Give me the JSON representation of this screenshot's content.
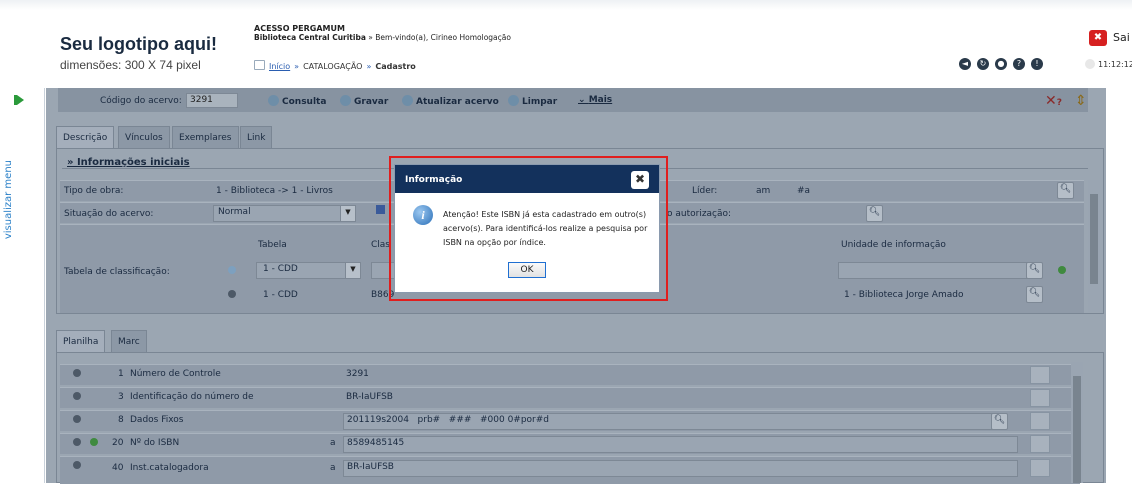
{
  "header": {
    "logo_title": "Seu logotipo aqui!",
    "logo_dimensions": "dimensões: 300 X 74 pixel",
    "system_name": "ACESSO PERGAMUM",
    "library_line_bold": "Biblioteca Central Curitiba",
    "library_line_rest": " » Bem-vindo(a), Cirineo Homologação",
    "breadcrumb": {
      "home": "Início",
      "section": "CATALOGAÇÃO",
      "current": "Cadastro"
    },
    "sair_label": "Sai",
    "clock": "11:12:12"
  },
  "side_menu_label": "visualizar menu",
  "toolbar": {
    "codigo_label": "Código do acervo:",
    "codigo_value": "3291",
    "buttons": [
      "Consulta",
      "Gravar",
      "Atualizar acervo",
      "Limpar",
      "Mais"
    ],
    "help_label": "?"
  },
  "tabs": [
    "Descrição",
    "Vínculos",
    "Exemplares",
    "Link"
  ],
  "section_title": "» Informações iniciais",
  "form": {
    "tipo_obra_label": "Tipo de obra:",
    "tipo_obra_value": "1 - Biblioteca -> 1 - Livros",
    "lider_label": "Líder:",
    "lider_value1": "am",
    "lider_value2": "#a",
    "situacao_label": "Situação do acervo:",
    "situacao_value": "Normal",
    "autorizacao_label": "o autorização:",
    "tabela_label": "Tabela de classificação:",
    "col_tabela": "Tabela",
    "col_classe": "Clas",
    "col_unidade": "Unidade de informação",
    "row1_tabela": "1 - CDD",
    "row2_tabela": "1 - CDD",
    "row2_classe": "B869",
    "row2_unidade": "1 - Biblioteca Jorge Amado"
  },
  "bottom_tabs": [
    "Planilha",
    "Marc"
  ],
  "planilha": [
    {
      "num": "1",
      "label": "Número de Controle",
      "sub": "",
      "value": "3291"
    },
    {
      "num": "3",
      "label": "Identificação do número de",
      "sub": "",
      "value": "BR-IaUFSB"
    },
    {
      "num": "8",
      "label": "Dados Fixos",
      "sub": "",
      "value": "201119s2004   prb#   ###   #000 0#por#d"
    },
    {
      "num": "20",
      "label": "Nº do ISBN",
      "sub": "a",
      "value": "8589485145"
    },
    {
      "num": "40",
      "label": "Inst.catalogadora",
      "sub": "a",
      "value": "BR-IaUFSB"
    }
  ],
  "dialog": {
    "title": "Informação",
    "message": "Atenção! Este ISBN já esta cadastrado em outro(s) acervo(s). Para identificá-los realize a pesquisa por ISBN na opção por índice.",
    "ok_label": "OK",
    "close_glyph": "✖"
  },
  "colors": {
    "dialog_title_bg": "#13315c",
    "highlight_border": "#e01e1e",
    "overlay_bg": "#9ba6b2"
  }
}
